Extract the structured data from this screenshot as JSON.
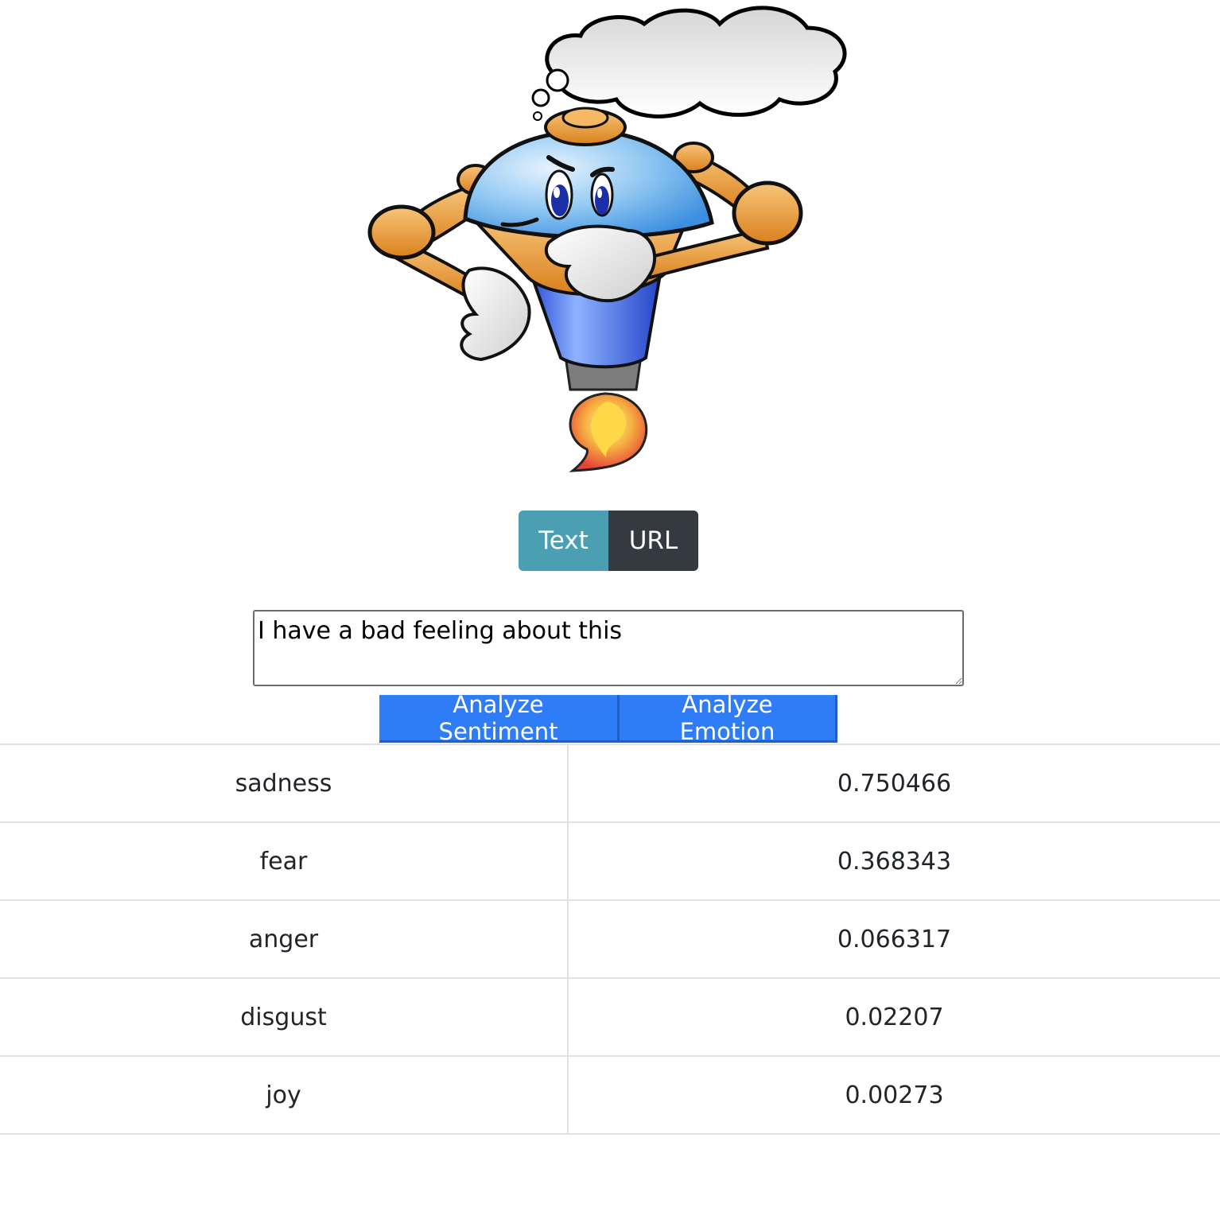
{
  "mascot": {
    "icon": "thinking-robot-mascot"
  },
  "mode_toggle": {
    "text_label": "Text",
    "url_label": "URL",
    "active": "Text",
    "colors": {
      "active": "#4a9fb2",
      "inactive": "#343a40"
    }
  },
  "input": {
    "value": "I have a bad feeling about this"
  },
  "actions": {
    "sentiment_label": "Analyze Sentiment",
    "emotion_label": "Analyze Emotion",
    "color": "#2f7df6"
  },
  "results": {
    "rows": [
      {
        "emotion": "sadness",
        "score": "0.750466"
      },
      {
        "emotion": "fear",
        "score": "0.368343"
      },
      {
        "emotion": "anger",
        "score": "0.066317"
      },
      {
        "emotion": "disgust",
        "score": "0.02207"
      },
      {
        "emotion": "joy",
        "score": "0.00273"
      }
    ]
  }
}
